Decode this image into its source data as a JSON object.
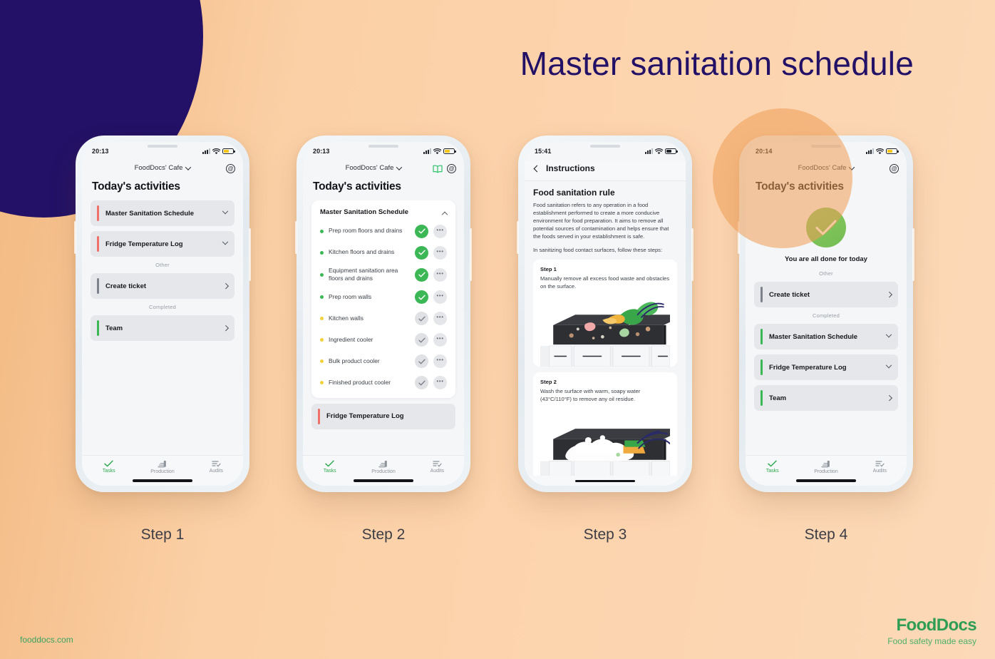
{
  "title": "Master sanitation schedule",
  "colors": {
    "navy": "#221166",
    "background_peach": "#fbd0a6",
    "accent_green": "#3cb756",
    "accent_red": "#f0706a",
    "accent_yellow": "#f2d13c",
    "accent_grey": "#7d828a",
    "brand_green": "#2f9e54"
  },
  "footer": {
    "url": "fooddocs.com",
    "brand_name": "FoodDocs",
    "brand_tagline": "Food safety made easy"
  },
  "captions": [
    "Step 1",
    "Step 2",
    "Step 3",
    "Step 4"
  ],
  "nav": {
    "items": [
      {
        "label": "Tasks",
        "icon": "check-icon",
        "active": true
      },
      {
        "label": "Production",
        "icon": "production-icon",
        "active": false
      },
      {
        "label": "Audits",
        "icon": "audits-icon",
        "active": false
      }
    ]
  },
  "phone1": {
    "status": {
      "time": "20:13",
      "battery": "low"
    },
    "header": {
      "org": "FoodDocs' Cafe",
      "chevron": "chevron-down-icon",
      "account_icon": "account-circle-icon"
    },
    "heading": "Today's activities",
    "rows": [
      {
        "label": "Master Sanitation Schedule",
        "color": "#f0706a",
        "chevron": "down"
      },
      {
        "label": "Fridge Temperature Log",
        "color": "#f0706a",
        "chevron": "down"
      }
    ],
    "section_other": "Other",
    "other_rows": [
      {
        "label": "Create ticket",
        "color": "#7d828a",
        "chevron": "right"
      }
    ],
    "section_completed": "Completed",
    "completed_rows": [
      {
        "label": "Team",
        "color": "#3cb756",
        "chevron": "right"
      }
    ]
  },
  "phone2": {
    "status": {
      "time": "20:13",
      "battery": "low"
    },
    "header": {
      "org": "FoodDocs' Cafe",
      "chevron": "chevron-down-icon",
      "book_icon": "book-icon",
      "account_icon": "account-circle-icon"
    },
    "heading": "Today's activities",
    "card": {
      "title": "Master Sanitation Schedule",
      "collapse_icon": "chevron-up-icon",
      "tasks": [
        {
          "label": "Prep room floors and drains",
          "dot": "#3cb756",
          "state": "done"
        },
        {
          "label": "Kitchen floors and drains",
          "dot": "#3cb756",
          "state": "done"
        },
        {
          "label": "Equipment sanitation area floors and drains",
          "dot": "#3cb756",
          "state": "done"
        },
        {
          "label": "Prep room walls",
          "dot": "#3cb756",
          "state": "done"
        },
        {
          "label": "Kitchen walls",
          "dot": "#f2d13c",
          "state": "pending"
        },
        {
          "label": "Ingredient cooler",
          "dot": "#f2d13c",
          "state": "pending"
        },
        {
          "label": "Bulk product cooler",
          "dot": "#f2d13c",
          "state": "pending"
        },
        {
          "label": "Finished product cooler",
          "dot": "#f2d13c",
          "state": "pending"
        }
      ]
    },
    "next_row": {
      "label": "Fridge Temperature Log",
      "color": "#f0706a"
    }
  },
  "phone3": {
    "status": {
      "time": "15:41",
      "battery": "dark"
    },
    "nav_title": "Instructions",
    "back_icon": "chevron-left-icon",
    "h2": "Food sanitation rule",
    "paragraphs": [
      "Food sanitation refers to any operation in a food establishment performed to create a more conducive environment for food preparation. It aims to remove all potential sources of contamination and helps ensure that the foods served in your establishment is safe.",
      "In sanitizing food contact surfaces, follow these steps:"
    ],
    "steps": [
      {
        "number": "Step 1",
        "text": "Manually remove all excess food waste and obstacles on the surface."
      },
      {
        "number": "Step 2",
        "text": "Wash the surface with warm, soapy water (43°C/110°F) to remove any oil residue."
      }
    ]
  },
  "phone4": {
    "status": {
      "time": "20:14",
      "battery": "low"
    },
    "header": {
      "org": "FoodDocs' Cafe",
      "chevron": "chevron-down-icon",
      "account_icon": "account-circle-icon"
    },
    "heading": "Today's activities",
    "done_icon": "check-circle-icon",
    "done_message": "You are all done for today",
    "section_other": "Other",
    "other_rows": [
      {
        "label": "Create ticket",
        "color": "#7d828a",
        "chevron": "right"
      }
    ],
    "section_completed": "Completed",
    "completed_rows": [
      {
        "label": "Master Sanitation Schedule",
        "color": "#3cb756",
        "chevron": "down"
      },
      {
        "label": "Fridge Temperature Log",
        "color": "#3cb756",
        "chevron": "down"
      },
      {
        "label": "Team",
        "color": "#3cb756",
        "chevron": "right"
      }
    ]
  }
}
